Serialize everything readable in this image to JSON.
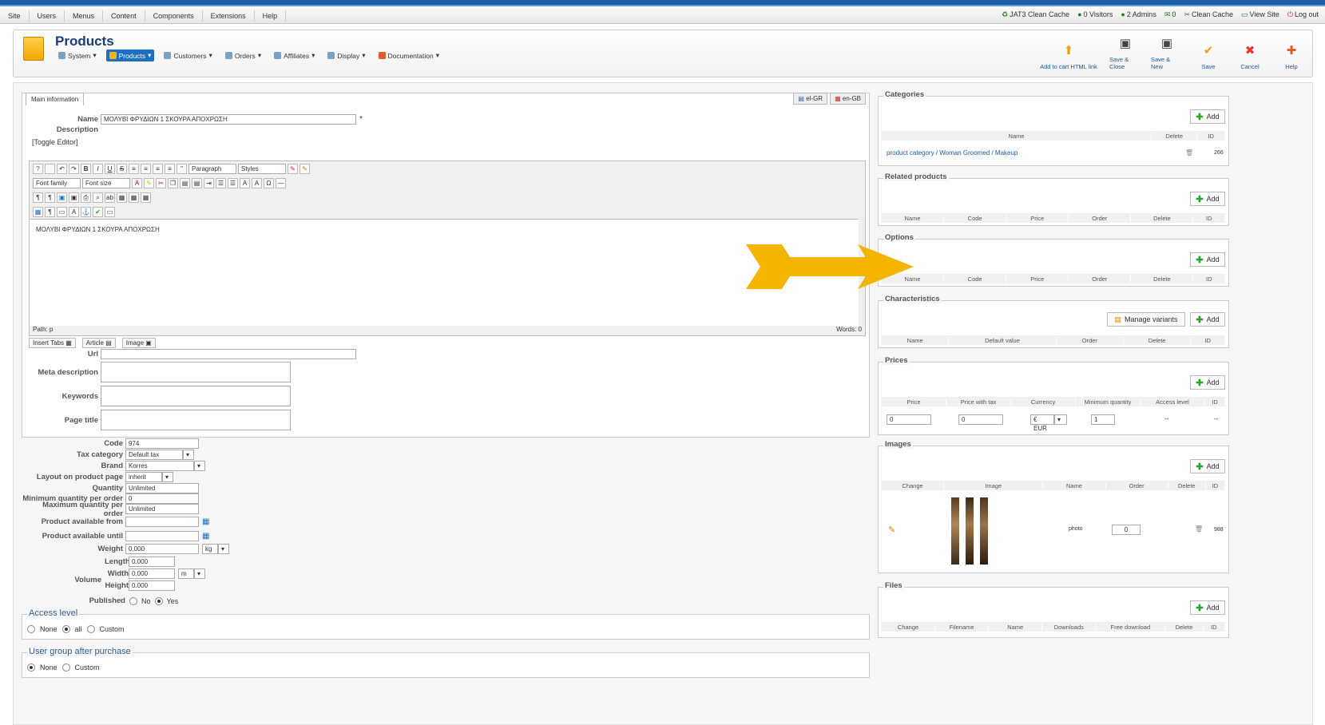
{
  "menubar": [
    "Site",
    "Users",
    "Menus",
    "Content",
    "Components",
    "Extensions",
    "Help"
  ],
  "status": [
    "JAT3 Clean Cache",
    "0 Visitors",
    "2 Admins",
    "0",
    "Clean Cache",
    "View Site",
    "Log out"
  ],
  "page": {
    "title": "Products"
  },
  "submenu": [
    "System",
    "Products",
    "Customers",
    "Orders",
    "Affiliates",
    "Display",
    "Documentation"
  ],
  "toolbar": [
    "Add to cart HTML link",
    "Save & Close",
    "Save & New",
    "Save",
    "Cancel",
    "Help"
  ],
  "tabs": {
    "main": "Main information",
    "lang1": "el-GR",
    "lang2": "en-GB"
  },
  "form": {
    "name_label": "Name",
    "name_value": "ΜΟΛΥΒΙ ΦΡΥΔΙΩΝ 1 ΣΚΟΥΡΑ ΑΠΟΧΡΩΣΗ",
    "desc_label": "Description",
    "toggle": "[Toggle Editor]",
    "editor_text": "ΜΟΛΥΒΙ ΦΡΥΔΙΩΝ 1 ΣΚΟΥΡΑ ΑΠΟΧΡΩΣΗ",
    "path": "Path: p",
    "words": "Words: 0",
    "font_family": "Font family",
    "font_size": "Font size",
    "paragraph": "Paragraph",
    "styles": "Styles",
    "insert_tabs": "Insert Tabs",
    "article": "Article",
    "image": "Image",
    "url_label": "Url",
    "meta_label": "Meta description",
    "keywords_label": "Keywords",
    "pagetitle_label": "Page title"
  },
  "details": [
    {
      "label": "Code",
      "value": "974"
    },
    {
      "label": "Tax category",
      "value": "Default tax category"
    },
    {
      "label": "Brand",
      "value": "Korres"
    },
    {
      "label": "Layout on product page",
      "value": "inherit"
    },
    {
      "label": "Quantity",
      "value": "Unlimited"
    },
    {
      "label": "Minimum quantity per order",
      "value": "0"
    },
    {
      "label": "Maximum quantity per order",
      "value": "Unlimited"
    },
    {
      "label": "Product available from",
      "value": ""
    },
    {
      "label": "Product available until",
      "value": ""
    },
    {
      "label": "Weight",
      "value": "0.000"
    }
  ],
  "weight_unit": "kg",
  "volume": {
    "label": "Volume",
    "length_label": "Length",
    "length": "0.000",
    "width_label": "Width",
    "width": "0.000",
    "height_label": "Height",
    "height": "0.000",
    "unit": "m"
  },
  "published": {
    "label": "Published",
    "no": "No",
    "yes": "Yes"
  },
  "access": {
    "legend": "Access level",
    "none": "None",
    "all": "all",
    "custom": "Custom"
  },
  "usergroup": {
    "legend": "User group after purchase",
    "none": "None",
    "custom": "Custom"
  },
  "categories": {
    "legend": "Categories",
    "add": "Add",
    "cols": [
      "Name",
      "Delete",
      "ID"
    ],
    "row": {
      "name": "product category / Woman Groomed / Makeup",
      "id": "266"
    }
  },
  "related": {
    "legend": "Related products",
    "add": "Add",
    "cols": [
      "Name",
      "Code",
      "Price",
      "Order",
      "Delete",
      "ID"
    ]
  },
  "options": {
    "legend": "Options",
    "add": "Add",
    "cols": [
      "Name",
      "Code",
      "Price",
      "Order",
      "Delete",
      "ID"
    ]
  },
  "characteristics": {
    "legend": "Characteristics",
    "manage": "Manage variants",
    "add": "Add",
    "cols": [
      "Name",
      "Default value",
      "Order",
      "Delete",
      "ID"
    ]
  },
  "prices": {
    "legend": "Prices",
    "add": "Add",
    "cols": [
      "Price",
      "Price with tax",
      "Currency",
      "Minimum quantity",
      "Access level",
      "ID"
    ],
    "row": {
      "price": "0",
      "tax": "0",
      "currency": "€ EUR",
      "minq": "1",
      "access": "--",
      "id": "--"
    }
  },
  "images": {
    "legend": "Images",
    "add": "Add",
    "cols": [
      "Change",
      "Image",
      "Name",
      "Order",
      "Delete",
      "ID"
    ],
    "row": {
      "name": "photo",
      "order": "0",
      "id": "988"
    }
  },
  "files": {
    "legend": "Files",
    "add": "Add",
    "cols": [
      "Change",
      "Filename",
      "Name",
      "Downloads",
      "Free download",
      "Delete",
      "ID"
    ]
  },
  "colors": {
    "accent": "#1d6fc4",
    "arrow": "#f5b400"
  }
}
